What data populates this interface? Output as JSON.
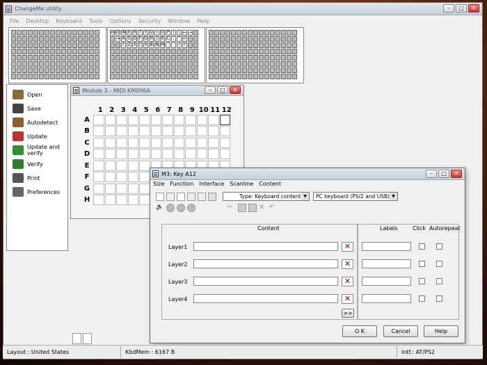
{
  "app": {
    "title": "ChangeMe utility"
  },
  "menu": [
    "File",
    "Desktop",
    "Keyboard",
    "Tools",
    "Options",
    "Security",
    "Window",
    "Help"
  ],
  "kb_panel": {
    "row1": [
      "esc",
      "Q",
      "W",
      "E",
      "R",
      "T",
      "Y",
      "U",
      "I",
      "O",
      "P",
      "[",
      "]",
      "←",
      "→"
    ],
    "row2": [
      "⇥",
      "A",
      "S",
      "D",
      "F",
      "G",
      "H",
      "J",
      "K",
      "L",
      ";",
      "'",
      "↵"
    ],
    "row3": [
      "⇧",
      "Z",
      "X",
      "C",
      "V",
      "B",
      "N",
      "M",
      ",",
      ".",
      "/",
      "⇧"
    ]
  },
  "sidebar": [
    {
      "label": "Open",
      "icon": "folder-icon",
      "color": "#8b6a3a"
    },
    {
      "label": "Save",
      "icon": "save-icon",
      "color": "#444"
    },
    {
      "label": "Autodetect",
      "icon": "autodetect-icon",
      "color": "#8a6030"
    },
    {
      "label": "Update",
      "icon": "update-icon",
      "color": "#c03030"
    },
    {
      "label": "Update and verify",
      "icon": "update-verify-icon",
      "color": "#309030"
    },
    {
      "label": "Verify",
      "icon": "verify-icon",
      "color": "#308030"
    },
    {
      "label": "Print",
      "icon": "print-icon",
      "color": "#555"
    },
    {
      "label": "Preferences",
      "icon": "preferences-icon",
      "color": "#666"
    }
  ],
  "module": {
    "title": "Module 3 - MIDI KM096A",
    "cols": [
      "1",
      "2",
      "3",
      "4",
      "5",
      "6",
      "7",
      "8",
      "9",
      "10",
      "11",
      "12"
    ],
    "rows": [
      "A",
      "B",
      "C",
      "D",
      "E",
      "F",
      "G",
      "H"
    ]
  },
  "dialog": {
    "title": "M3: Key A12",
    "menu": [
      "Size",
      "Function",
      "Interface",
      "Scanline",
      "Content"
    ],
    "type_select": "Type: Keyboard content",
    "keyboard_select": "PC keyboard (PS/2 and USB)",
    "headers": {
      "content": "Content",
      "labels": "Labels",
      "click": "Click",
      "autorepeat": "Autorepeat"
    },
    "layers": [
      "Layer1",
      "Layer2",
      "Layer3",
      "Layer4"
    ],
    "more": ">>",
    "ok": "O K",
    "cancel": "Cancel",
    "help": "Help"
  },
  "status": {
    "layout": "Layout : United States",
    "mem": "KbdMem : 6167 B",
    "intf": "Intf.: AT/PS2"
  }
}
